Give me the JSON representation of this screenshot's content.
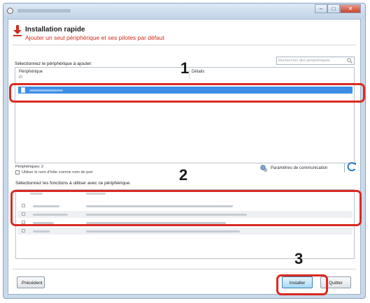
{
  "header": {
    "title": "Installation rapide",
    "subtitle": "Ajouter un seul périphérique et ses pilotes par défaut"
  },
  "devices": {
    "select_label": "Sélectionnez le périphérique à ajouter:",
    "search_placeholder": "Rechercher des périphériques",
    "col_device": "Périphérique",
    "col_details": "Détails",
    "col_sub": "ID",
    "count_label": "Périphériques: 2",
    "use_host_checkbox_label": "Utiliser le nom d'hôte comme nom de port",
    "comm_settings_label": "Paramètres de communication"
  },
  "functions": {
    "select_label": "Sélectionnez les fonctions à utiliser avec ce périphérique."
  },
  "footer": {
    "back_label": "Précédent",
    "install_label": "Installer",
    "quit_label": "Quitter"
  },
  "callouts": {
    "one": "1",
    "two": "2",
    "three": "3"
  },
  "colors": {
    "accent_red": "#d92a22",
    "selection_blue": "#3c8ee6",
    "subtitle_red": "#d12b1b"
  },
  "icons": [
    "app-icon",
    "download-arrow-icon",
    "search-icon",
    "document-icon",
    "network-settings-icon",
    "refresh-icon"
  ]
}
